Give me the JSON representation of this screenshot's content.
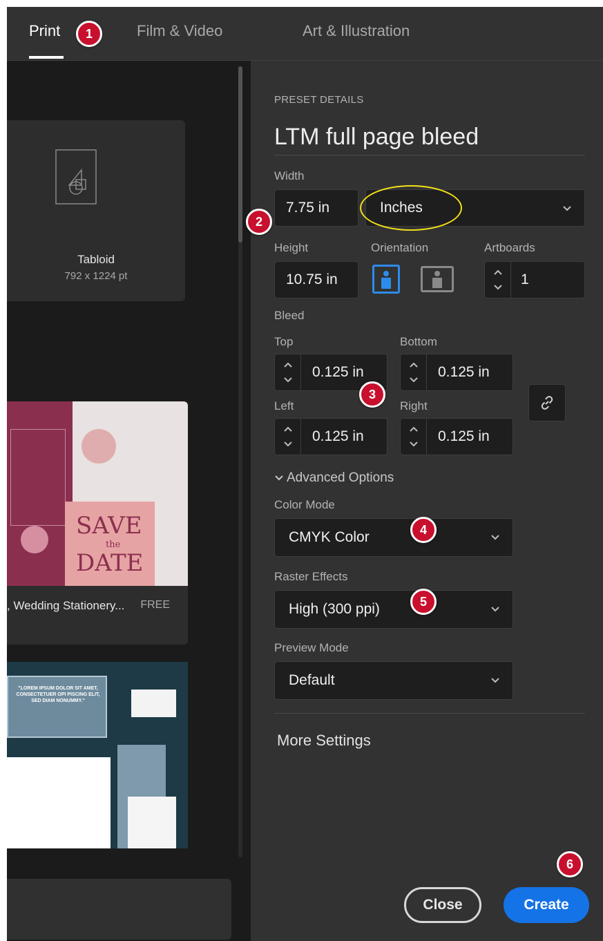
{
  "tabs": [
    {
      "label": "Print",
      "active": true
    },
    {
      "label": "Film & Video",
      "active": false
    },
    {
      "label": "Art & Illustration",
      "active": false
    }
  ],
  "markers": [
    "1",
    "2",
    "3",
    "4",
    "5",
    "6"
  ],
  "presets": {
    "tabloid": {
      "title": "Tabloid",
      "size": "792 x 1224 pt"
    },
    "wedding": {
      "title": ", Wedding Stationery...",
      "price": "FREE",
      "art_text_1": "SAVE",
      "art_text_2": "the",
      "art_text_3": "DATE"
    },
    "stationery": {
      "quote": "\"LOREM IPSUM DOLOR SIT AMET, CONSECTETUER OPI PISCING ELIT, SED DIAM NONUMMY.\""
    }
  },
  "details": {
    "section_label": "PRESET DETAILS",
    "preset_name": "LTM full page bleed",
    "width_label": "Width",
    "width_value": "7.75 in",
    "unit_value": "Inches",
    "height_label": "Height",
    "height_value": "10.75 in",
    "orientation_label": "Orientation",
    "orientation_selected": "portrait",
    "artboards_label": "Artboards",
    "artboards_value": "1",
    "bleed_label": "Bleed",
    "bleed": {
      "top_label": "Top",
      "top_value": "0.125 in",
      "bottom_label": "Bottom",
      "bottom_value": "0.125 in",
      "left_label": "Left",
      "left_value": "0.125 in",
      "right_label": "Right",
      "right_value": "0.125 in"
    },
    "advanced_label": "Advanced Options",
    "color_mode_label": "Color Mode",
    "color_mode_value": "CMYK Color",
    "raster_label": "Raster Effects",
    "raster_value": "High (300 ppi)",
    "preview_label": "Preview Mode",
    "preview_value": "Default",
    "more_settings": "More Settings"
  },
  "buttons": {
    "close": "Close",
    "create": "Create"
  },
  "colors": {
    "accent": "#1473e6",
    "marker": "#c8102e",
    "highlight": "#f2e11a",
    "panel": "#323232",
    "field": "#1e1e1e"
  }
}
